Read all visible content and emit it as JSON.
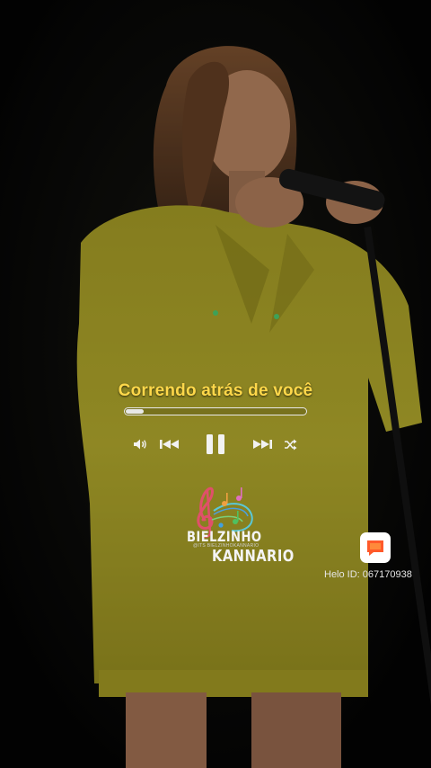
{
  "lyric": {
    "text": "Correndo atrás de você"
  },
  "player": {
    "progress": 0.1,
    "controls": [
      "volume",
      "previous",
      "pause",
      "next",
      "shuffle"
    ]
  },
  "logo": {
    "line1": "BIELZINHO",
    "sub": "@ITS BIELZINHOKANNARIO",
    "line2": "KANNARIO"
  },
  "watermark": {
    "helo_id": "Helo ID: 067170938"
  },
  "colors": {
    "lyric": "#ffd84a",
    "jacket": "#c9bf2e",
    "badge_bg": "#ffffff",
    "badge_icon": "#ff5a2a"
  },
  "icons": {
    "volume": "volume-icon",
    "previous": "rewind-icon",
    "pause": "pause-icon",
    "next": "fast-forward-icon",
    "shuffle": "shuffle-icon",
    "app": "helo-app-icon"
  }
}
